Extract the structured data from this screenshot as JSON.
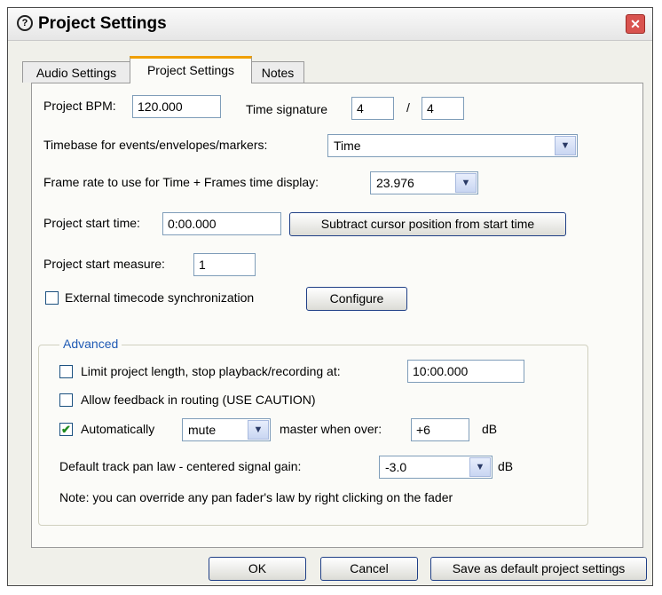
{
  "window": {
    "title": "Project Settings",
    "close_glyph": "✕",
    "app_icon_glyph": "?"
  },
  "tabs": [
    {
      "label": "Audio Settings",
      "active": false
    },
    {
      "label": "Project Settings",
      "active": true
    },
    {
      "label": "Notes",
      "active": false
    }
  ],
  "project": {
    "bpm_label": "Project BPM:",
    "bpm_value": "120.000",
    "time_sig_label": "Time signature",
    "time_sig_num": "4",
    "time_sig_sep": "/",
    "time_sig_den": "4",
    "timebase_label": "Timebase for events/envelopes/markers:",
    "timebase_value": "Time",
    "framerate_label": "Frame rate to use for Time + Frames time display:",
    "framerate_value": "23.976",
    "start_time_label": "Project start time:",
    "start_time_value": "0:00.000",
    "subtract_button": "Subtract cursor position from start time",
    "start_measure_label": "Project start measure:",
    "start_measure_value": "1",
    "ext_timecode_label": "External timecode synchronization",
    "ext_timecode_checked": false,
    "configure_button": "Configure"
  },
  "advanced": {
    "title": "Advanced",
    "limit_label": "Limit project length, stop playback/recording at:",
    "limit_checked": false,
    "limit_value": "10:00.000",
    "feedback_label": "Allow feedback in routing (USE CAUTION)",
    "feedback_checked": false,
    "auto_label": "Automatically",
    "auto_checked": true,
    "auto_action": "mute",
    "master_label": "master when over:",
    "master_value": "+6",
    "db_unit": "dB",
    "panlaw_label": "Default track pan law - centered signal gain:",
    "panlaw_value": "-3.0",
    "panlaw_unit": "dB",
    "note": "Note: you can override any pan fader's law by right clicking on the fader"
  },
  "footer": {
    "ok": "OK",
    "cancel": "Cancel",
    "save_default": "Save as default project settings"
  },
  "icons": {
    "dropdown": "▼",
    "checkmark": "✔"
  }
}
